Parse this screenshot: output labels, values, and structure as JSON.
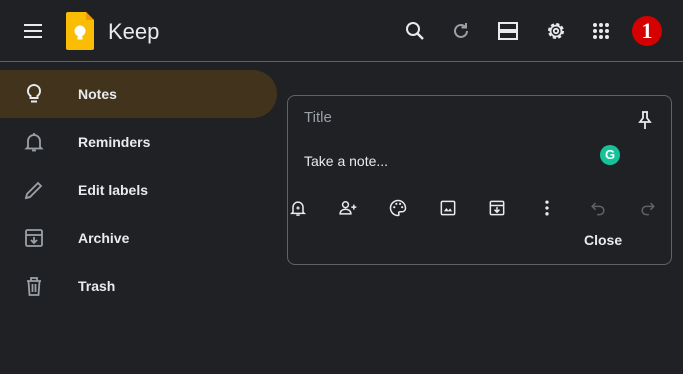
{
  "header": {
    "app_name": "Keep",
    "icons": [
      "menu-icon",
      "keep-logo",
      "search-icon",
      "refresh-icon",
      "list-view-icon",
      "settings-icon",
      "apps-icon"
    ],
    "notification_badge": "1"
  },
  "sidebar": {
    "items": [
      {
        "label": "Notes",
        "icon": "lightbulb-icon",
        "active": true
      },
      {
        "label": "Reminders",
        "icon": "bell-icon",
        "active": false
      },
      {
        "label": "Edit labels",
        "icon": "pencil-icon",
        "active": false
      },
      {
        "label": "Archive",
        "icon": "archive-icon",
        "active": false
      },
      {
        "label": "Trash",
        "icon": "trash-icon",
        "active": false
      }
    ]
  },
  "note_editor": {
    "title_placeholder": "Title",
    "body_placeholder": "Take a note...",
    "grammarly_letter": "G",
    "toolbar_icons": [
      "remind-me-icon",
      "collaborator-icon",
      "background-options-icon",
      "add-image-icon",
      "archive-icon",
      "more-icon",
      "undo-icon",
      "redo-icon"
    ],
    "close_label": "Close"
  },
  "colors": {
    "background": "#202124",
    "active_nav": "#41331c",
    "keep_yellow": "#fbbc04",
    "badge_red": "#d50000",
    "grammarly_green": "#15c39a"
  }
}
